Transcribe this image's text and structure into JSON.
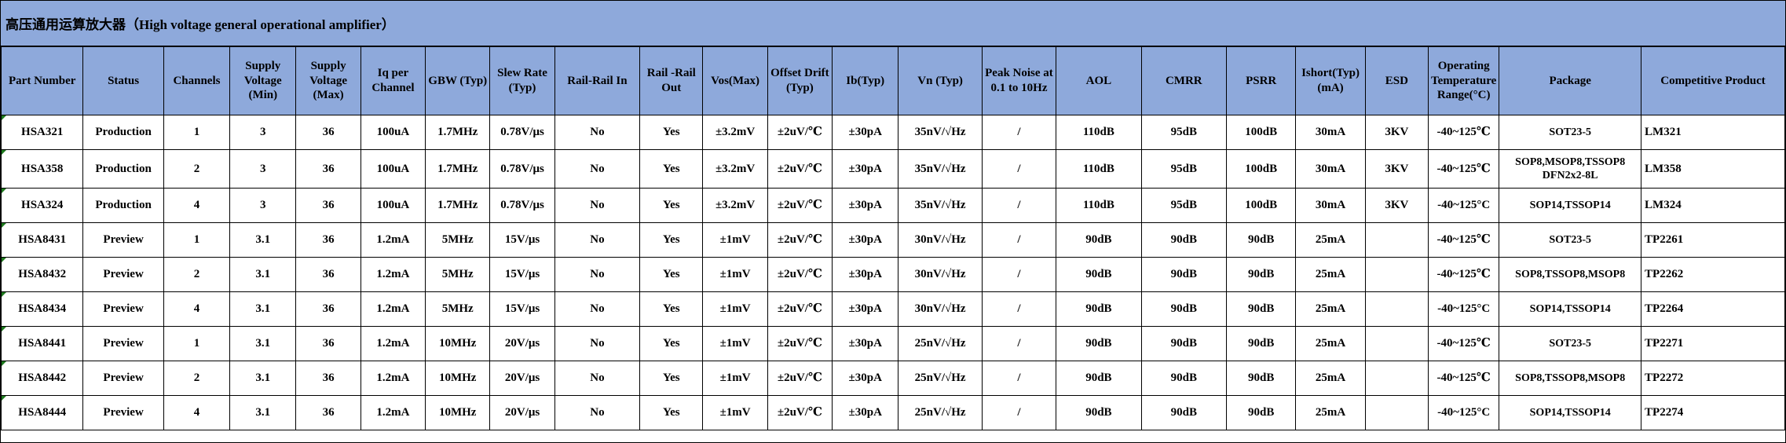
{
  "title": "高压通用运算放大器（High voltage general operational amplifier）",
  "columns": [
    "Part Number",
    "Status",
    "Channels",
    "Supply Voltage (Min)",
    "Supply Voltage (Max)",
    "Iq per Channel",
    "GBW (Typ)",
    "Slew Rate (Typ)",
    "Rail-Rail In",
    "Rail -Rail Out",
    "Vos(Max)",
    "Offset Drift (Typ)",
    "Ib(Typ)",
    "Vn (Typ)",
    "Peak Noise at 0.1 to 10Hz",
    "AOL",
    "CMRR",
    "PSRR",
    "Ishort(Typ)(mA)",
    "ESD",
    "Operating Temperature Range(°C)",
    "Package",
    "Competitive Product"
  ],
  "rows": [
    [
      "HSA321",
      "Production",
      "1",
      "3",
      "36",
      "100uA",
      "1.7MHz",
      "0.78V/μs",
      "No",
      "Yes",
      "±3.2mV",
      "±2uV/℃",
      "±30pA",
      "35nV/√Hz",
      "/",
      "110dB",
      "95dB",
      "100dB",
      "30mA",
      "3KV",
      "-40~125℃",
      "SOT23-5",
      "LM321"
    ],
    [
      "HSA358",
      "Production",
      "2",
      "3",
      "36",
      "100uA",
      "1.7MHz",
      "0.78V/μs",
      "No",
      "Yes",
      "±3.2mV",
      "±2uV/℃",
      "±30pA",
      "35nV/√Hz",
      "/",
      "110dB",
      "95dB",
      "100dB",
      "30mA",
      "3KV",
      "-40~125℃",
      "SOP8,MSOP8,TSSOP8 DFN2x2-8L",
      "LM358"
    ],
    [
      "HSA324",
      "Production",
      "4",
      "3",
      "36",
      "100uA",
      "1.7MHz",
      "0.78V/μs",
      "No",
      "Yes",
      "±3.2mV",
      "±2uV/℃",
      "±30pA",
      "35nV/√Hz",
      "/",
      "110dB",
      "95dB",
      "100dB",
      "30mA",
      "3KV",
      "-40~125°C",
      "SOP14,TSSOP14",
      "LM324"
    ],
    [
      "HSA8431",
      "Preview",
      "1",
      "3.1",
      "36",
      "1.2mA",
      "5MHz",
      "15V/μs",
      "No",
      "Yes",
      "±1mV",
      "±2uV/℃",
      "±30pA",
      "30nV/√Hz",
      "/",
      "90dB",
      "90dB",
      "90dB",
      "25mA",
      "",
      "-40~125℃",
      "SOT23-5",
      "TP2261"
    ],
    [
      "HSA8432",
      "Preview",
      "2",
      "3.1",
      "36",
      "1.2mA",
      "5MHz",
      "15V/μs",
      "No",
      "Yes",
      "±1mV",
      "±2uV/℃",
      "±30pA",
      "30nV/√Hz",
      "/",
      "90dB",
      "90dB",
      "90dB",
      "25mA",
      "",
      "-40~125℃",
      "SOP8,TSSOP8,MSOP8",
      "TP2262"
    ],
    [
      "HSA8434",
      "Preview",
      "4",
      "3.1",
      "36",
      "1.2mA",
      "5MHz",
      "15V/μs",
      "No",
      "Yes",
      "±1mV",
      "±2uV/℃",
      "±30pA",
      "30nV/√Hz",
      "/",
      "90dB",
      "90dB",
      "90dB",
      "25mA",
      "",
      "-40~125°C",
      "SOP14,TSSOP14",
      "TP2264"
    ],
    [
      "HSA8441",
      "Preview",
      "1",
      "3.1",
      "36",
      "1.2mA",
      "10MHz",
      "20V/μs",
      "No",
      "Yes",
      "±1mV",
      "±2uV/℃",
      "±30pA",
      "25nV/√Hz",
      "/",
      "90dB",
      "90dB",
      "90dB",
      "25mA",
      "",
      "-40~125℃",
      "SOT23-5",
      "TP2271"
    ],
    [
      "HSA8442",
      "Preview",
      "2",
      "3.1",
      "36",
      "1.2mA",
      "10MHz",
      "20V/μs",
      "No",
      "Yes",
      "±1mV",
      "±2uV/℃",
      "±30pA",
      "25nV/√Hz",
      "/",
      "90dB",
      "90dB",
      "90dB",
      "25mA",
      "",
      "-40~125℃",
      "SOP8,TSSOP8,MSOP8",
      "TP2272"
    ],
    [
      "HSA8444",
      "Preview",
      "4",
      "3.1",
      "36",
      "1.2mA",
      "10MHz",
      "20V/μs",
      "No",
      "Yes",
      "±1mV",
      "±2uV/℃",
      "±30pA",
      "25nV/√Hz",
      "/",
      "90dB",
      "90dB",
      "90dB",
      "25mA",
      "",
      "-40~125°C",
      "SOP14,TSSOP14",
      "TP2274"
    ]
  ]
}
